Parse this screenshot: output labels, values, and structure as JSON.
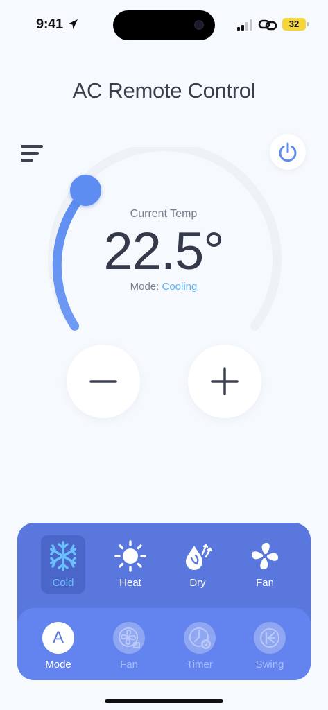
{
  "status_bar": {
    "time": "9:41",
    "battery": "32",
    "icons": [
      "location-arrow-icon",
      "signal-icon",
      "link-icon",
      "battery-icon"
    ]
  },
  "title": "AC Remote Control",
  "thermostat": {
    "label": "Current Temp",
    "value": "22.5°",
    "mode_prefix": "Mode:",
    "mode_value": "Cooling",
    "level_fraction": 0.25
  },
  "modes": [
    {
      "label": "Cold",
      "icon": "snowflake-icon",
      "active": true
    },
    {
      "label": "Heat",
      "icon": "sun-icon",
      "active": false
    },
    {
      "label": "Dry",
      "icon": "droplets-icon",
      "active": false
    },
    {
      "label": "Fan",
      "icon": "fan-icon",
      "active": false
    }
  ],
  "controls": [
    {
      "label": "Mode",
      "icon": "mode-letter-icon",
      "glyph": "A",
      "active": true
    },
    {
      "label": "Fan",
      "icon": "fan-speed-icon",
      "active": false
    },
    {
      "label": "Timer",
      "icon": "timer-icon",
      "active": false
    },
    {
      "label": "Swing",
      "icon": "swing-icon",
      "active": false
    }
  ],
  "colors": {
    "accent": "#5d8df1",
    "panel": "#5977dc",
    "panel_inner": "#6384ef",
    "mode_active_text": "#6cc0ff",
    "background": "#f6f9fd"
  }
}
